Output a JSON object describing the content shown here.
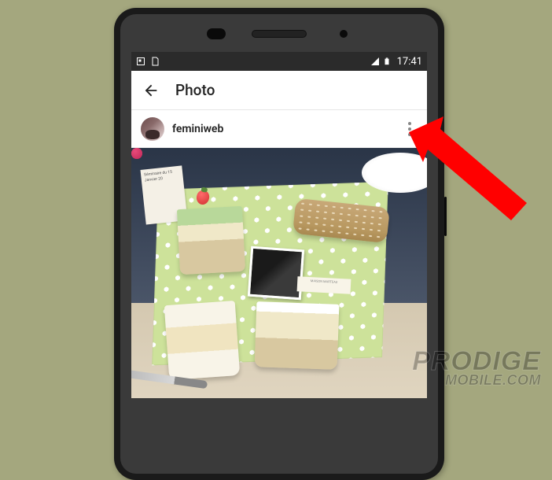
{
  "status_bar": {
    "time": "17:41"
  },
  "app_bar": {
    "title": "Photo"
  },
  "post": {
    "username": "feminiweb",
    "card_text": "Séminaire du 15 Janvier 20",
    "label_text": "MAISON MARTEAU"
  },
  "watermark": {
    "line1": "PRODIGE",
    "line2": "MOBILE.COM"
  }
}
